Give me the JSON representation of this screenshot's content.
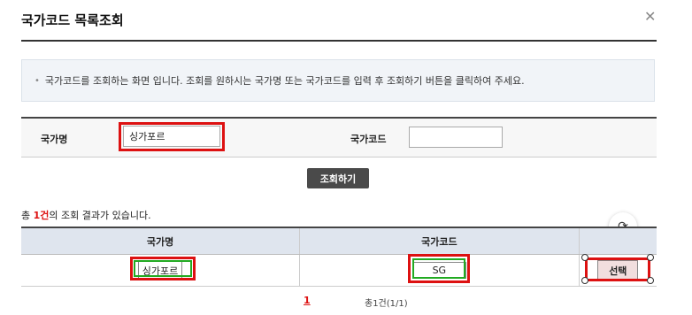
{
  "dialog": {
    "title": "국가코드 목록조회",
    "close_icon": "close-icon"
  },
  "info": {
    "text": "국가코드를 조회하는 화면 입니다. 조회를 원하시는 국가명 또는 국가코드를 입력 후 조회하기 버튼을 클릭하여 주세요."
  },
  "search": {
    "country_name_label": "국가명",
    "country_name_value": "싱가포르",
    "country_code_label": "국가코드",
    "country_code_value": "",
    "button_label": "조회하기"
  },
  "result": {
    "count_prefix": "총 ",
    "count_num": "1건",
    "count_suffix": "의 조회 결과가 있습니다."
  },
  "table": {
    "headers": [
      "국가명",
      "국가코드",
      ""
    ],
    "rows": [
      {
        "name": "싱가포르",
        "code": "SG",
        "action": "선택"
      }
    ]
  },
  "pager": {
    "current": "1",
    "total": "총1건(1/1)"
  },
  "colors": {
    "highlight_red": "#dd1111",
    "highlight_green": "#22aa22",
    "header_bg": "#dfe5ee"
  }
}
